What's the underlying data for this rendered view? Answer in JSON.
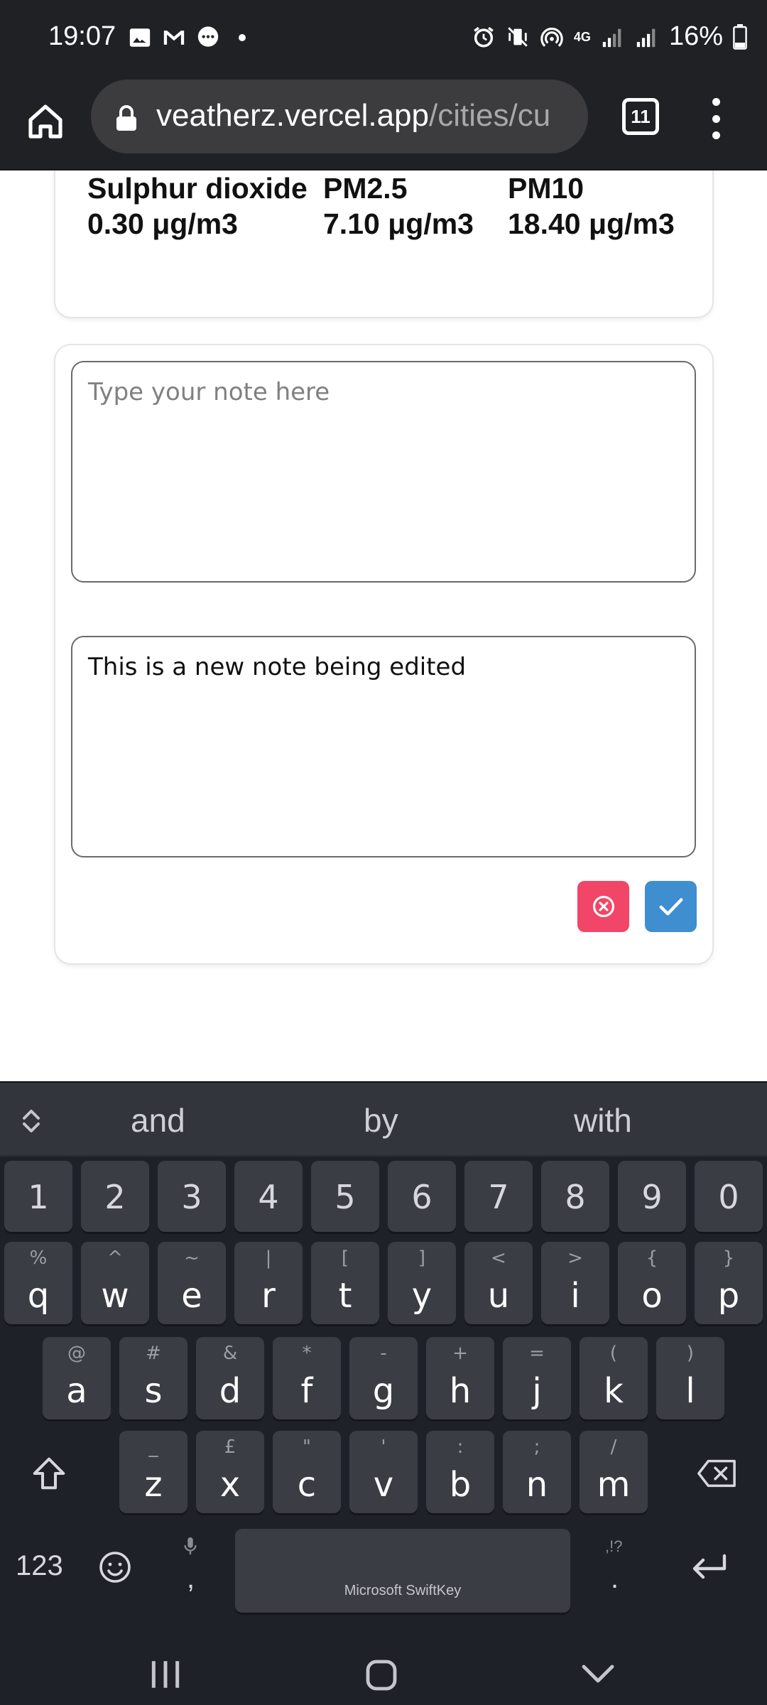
{
  "status_bar": {
    "time": "19:07",
    "battery": "16%",
    "left_icons": [
      "gallery-icon",
      "gmail-icon",
      "messages-icon"
    ],
    "right_icons": [
      "alarm-icon",
      "vibrate-icon",
      "hotspot-icon",
      "network-4g-icon",
      "signal-icon",
      "signal-icon",
      "battery-icon"
    ],
    "network_label": "4G"
  },
  "browser": {
    "url_host": "veatherz.vercel.app",
    "url_path": "/cities/cu",
    "tab_count": "11"
  },
  "air_quality": {
    "items": [
      {
        "name": "Sulphur dioxide",
        "value": "0.30 μg/m3"
      },
      {
        "name": "PM2.5",
        "value": "7.10 μg/m3"
      },
      {
        "name": "PM10",
        "value": "18.40 μg/m3"
      }
    ]
  },
  "notes": {
    "new_note_placeholder": "Type your note here",
    "new_note_value": "",
    "editing_note_value": "This is a new note being edited"
  },
  "keyboard": {
    "suggestions": [
      "and",
      "by",
      "with"
    ],
    "number_row": [
      "1",
      "2",
      "3",
      "4",
      "5",
      "6",
      "7",
      "8",
      "9",
      "0"
    ],
    "row1": [
      {
        "key": "q",
        "alt": "%"
      },
      {
        "key": "w",
        "alt": "^"
      },
      {
        "key": "e",
        "alt": "~"
      },
      {
        "key": "r",
        "alt": "|"
      },
      {
        "key": "t",
        "alt": "["
      },
      {
        "key": "y",
        "alt": "]"
      },
      {
        "key": "u",
        "alt": "<"
      },
      {
        "key": "i",
        "alt": ">"
      },
      {
        "key": "o",
        "alt": "{"
      },
      {
        "key": "p",
        "alt": "}"
      }
    ],
    "row2": [
      {
        "key": "a",
        "alt": "@"
      },
      {
        "key": "s",
        "alt": "#"
      },
      {
        "key": "d",
        "alt": "&"
      },
      {
        "key": "f",
        "alt": "*"
      },
      {
        "key": "g",
        "alt": "-"
      },
      {
        "key": "h",
        "alt": "+"
      },
      {
        "key": "j",
        "alt": "="
      },
      {
        "key": "k",
        "alt": "("
      },
      {
        "key": "l",
        "alt": ")"
      }
    ],
    "row3": [
      {
        "key": "z",
        "alt": "_"
      },
      {
        "key": "x",
        "alt": "£"
      },
      {
        "key": "c",
        "alt": "\""
      },
      {
        "key": "v",
        "alt": "'"
      },
      {
        "key": "b",
        "alt": ":"
      },
      {
        "key": "n",
        "alt": ";"
      },
      {
        "key": "m",
        "alt": "/"
      }
    ],
    "symbols_label": "123",
    "comma": ",",
    "period": ".",
    "period_alt": ",!?",
    "space_label": "Microsoft SwiftKey"
  }
}
